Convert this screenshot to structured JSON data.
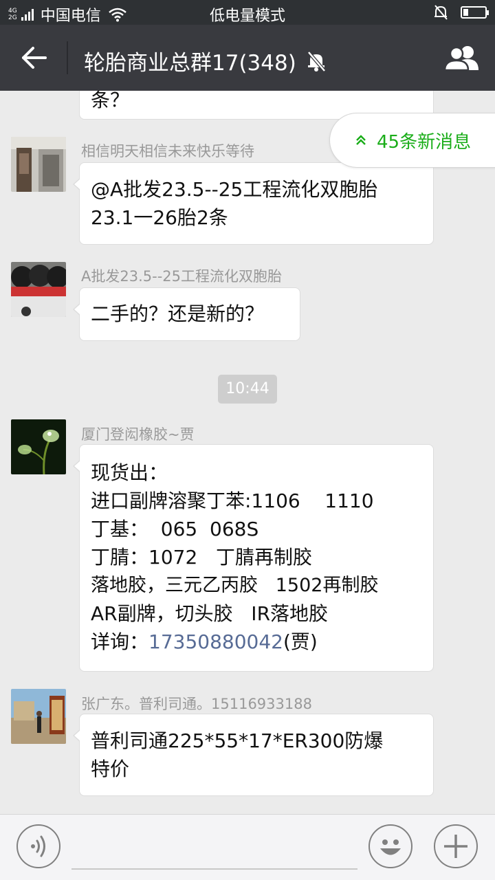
{
  "status_bar": {
    "network_top": "4G",
    "network_bottom": "2G",
    "carrier": "中国电信",
    "mode": "低电量模式",
    "battery_level": 0.2
  },
  "header": {
    "title": "轮胎商业总群17(348)",
    "icons": [
      "back-arrow-icon",
      "mute-icon",
      "group-members-icon"
    ]
  },
  "new_messages_label": "45条新消息",
  "messages": [
    {
      "bubble": {
        "lines": [
          "条？"
        ]
      }
    },
    {
      "sender": "相信明天相信未来快乐等待",
      "lines": [
        "@A批发23.5--25工程流化双胞胎",
        "23.1一26胎2条"
      ]
    },
    {
      "sender": "A批发23.5--25工程流化双胞胎",
      "lines": [
        "二手的？还是新的？"
      ]
    },
    {
      "time": "10:44"
    },
    {
      "sender": "厦门登闳橡胶~贾",
      "lines": [
        "现货出：",
        "进口副牌溶聚丁苯:1106    1110",
        "丁基：  065  068S",
        "丁腈：1072   丁腈再制胶",
        "落地胶，三元乙丙胶   1502再制胶",
        "AR副牌，切头胶   IR落地胶"
      ],
      "last_line_prefix": "详询：",
      "phone": "17350880042",
      "last_line_suffix": "(贾)"
    },
    {
      "sender": "张广东。普利司通。15116933188",
      "lines": [
        "普利司通225*55*17*ER300防爆",
        "特价"
      ]
    }
  ],
  "colors": {
    "title_bar": "#393a3f",
    "status_bar": "#2e3134",
    "background": "#ebebeb",
    "accent_green": "#1aad19",
    "link_blue": "#576b95"
  }
}
